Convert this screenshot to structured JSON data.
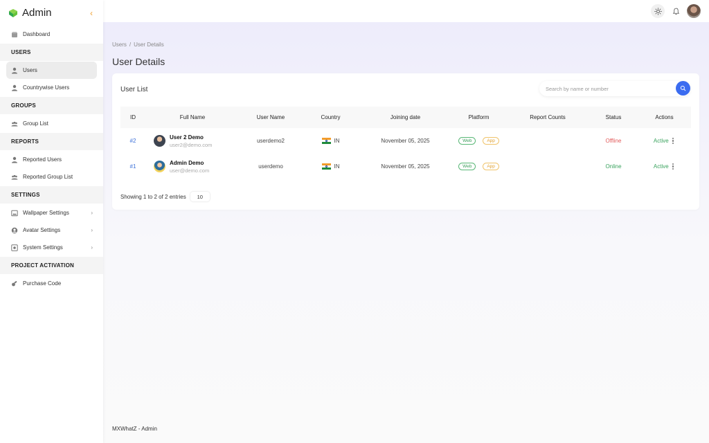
{
  "brand": {
    "title": "Admin"
  },
  "sidebar": {
    "dashboard": "Dashboard",
    "sections": {
      "users": "USERS",
      "groups": "GROUPS",
      "reports": "REPORTS",
      "settings": "SETTINGS",
      "project_activation": "PROJECT ACTIVATION"
    },
    "items": {
      "users": "Users",
      "countrywise_users": "Countrywise Users",
      "group_list": "Group List",
      "reported_users": "Reported Users",
      "reported_group_list": "Reported Group List",
      "wallpaper_settings": "Wallpaper Settings",
      "avatar_settings": "Avatar Settings",
      "system_settings": "System Settings",
      "purchase_code": "Purchase Code"
    }
  },
  "breadcrumb": {
    "root": "Users",
    "sep": "/",
    "current": "User Details"
  },
  "page": {
    "title": "User Details"
  },
  "card": {
    "title": "User List",
    "search_placeholder": "Search by name or number"
  },
  "table": {
    "headers": [
      "ID",
      "Full Name",
      "User Name",
      "Country",
      "Joining date",
      "Platform",
      "Report Counts",
      "Status",
      "Actions"
    ],
    "rows": [
      {
        "id": "#2",
        "name": "User 2 Demo",
        "email": "user2@demo.com",
        "username": "userdemo2",
        "country": "IN",
        "joined": "November 05, 2025",
        "platforms": [
          "Web",
          "App"
        ],
        "report_counts": "",
        "status": "Offline",
        "action": "Active"
      },
      {
        "id": "#1",
        "name": "Admin Demo",
        "email": "user@demo.com",
        "username": "userdemo",
        "country": "IN",
        "joined": "November 05, 2025",
        "platforms": [
          "Web",
          "App"
        ],
        "report_counts": "",
        "status": "Online",
        "action": "Active"
      }
    ],
    "footer_text": "Showing 1 to 2 of 2 entries",
    "page_size": "10"
  },
  "footer": {
    "text": "MXWhatZ - Admin"
  },
  "icons": {
    "brand": "leaf-logo-icon",
    "theme": "sun-icon",
    "notifications": "bell-icon"
  },
  "colors": {
    "accent": "#3b6cf0",
    "online": "#3aa35e",
    "offline": "#e25b5b"
  }
}
